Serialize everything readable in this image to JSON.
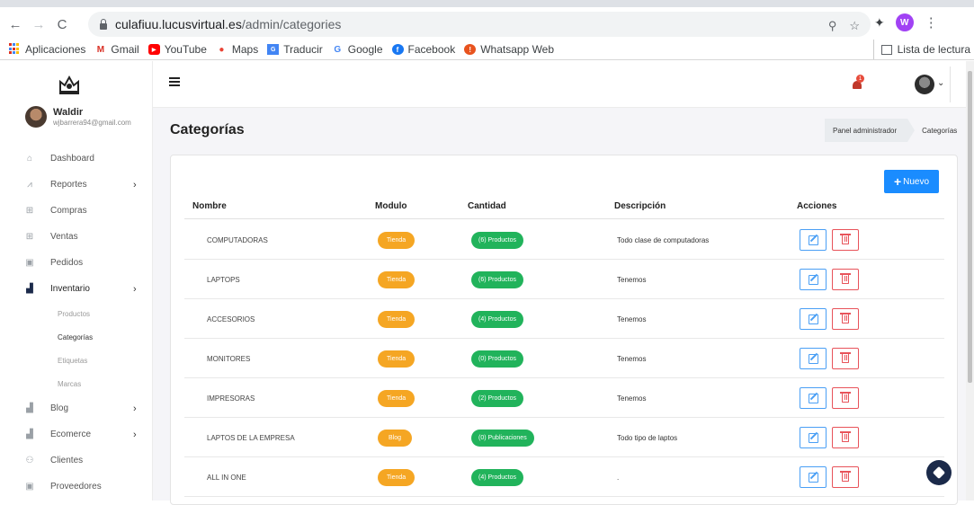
{
  "browser": {
    "url_host": "culafiuu.lucusvirtual.es",
    "url_path": "/admin/categories",
    "profile_initial": "W",
    "bookmarks": [
      "Aplicaciones",
      "Gmail",
      "YouTube",
      "Maps",
      "Traducir",
      "Google",
      "Facebook",
      "Whatsapp Web"
    ],
    "reading_list": "Lista de lectura"
  },
  "user": {
    "name": "Waldir",
    "email": "wjbarrera94@gmail.com"
  },
  "sidebar": {
    "items": [
      {
        "label": "Dashboard",
        "icon": "home-icon"
      },
      {
        "label": "Reportes",
        "icon": "chart-icon",
        "chevron": "›"
      },
      {
        "label": "Compras",
        "icon": "cart-icon"
      },
      {
        "label": "Ventas",
        "icon": "cart-icon"
      },
      {
        "label": "Pedidos",
        "icon": "truck-icon"
      },
      {
        "label": "Inventario",
        "icon": "boxes-icon",
        "chevron": "›"
      },
      {
        "label": "Blog",
        "icon": "boxes-icon",
        "chevron": "›"
      },
      {
        "label": "Ecomerce",
        "icon": "boxes-icon",
        "chevron": "›"
      },
      {
        "label": "Clientes",
        "icon": "users-icon"
      },
      {
        "label": "Proveedores",
        "icon": "truck-icon"
      }
    ],
    "inventario_sub": [
      "Productos",
      "Categorías",
      "Etiquetas",
      "Marcas"
    ]
  },
  "topbar": {
    "notification_count": "1"
  },
  "page": {
    "title": "Categorías",
    "breadcrumb": [
      "Panel administrador",
      "Categorías"
    ],
    "new_button": "Nuevo"
  },
  "table": {
    "headers": [
      "Nombre",
      "Modulo",
      "Cantidad",
      "Descripción",
      "Acciones"
    ],
    "rows": [
      {
        "name": "COMPUTADORAS",
        "module": "Tienda",
        "count": "(6) Productos",
        "description": "Todo clase de computadoras"
      },
      {
        "name": "LAPTOPS",
        "module": "Tienda",
        "count": "(6) Productos",
        "description": "Tenemos"
      },
      {
        "name": "ACCESORIOS",
        "module": "Tienda",
        "count": "(4) Productos",
        "description": "Tenemos"
      },
      {
        "name": "MONITORES",
        "module": "Tienda",
        "count": "(0) Productos",
        "description": "Tenemos"
      },
      {
        "name": "IMPRESORAS",
        "module": "Tienda",
        "count": "(2) Productos",
        "description": "Tenemos"
      },
      {
        "name": "LAPTOS DE LA EMPRESA",
        "module": "Blog",
        "count": "(0) Publicaciones",
        "description": "Todo tipo de laptos"
      },
      {
        "name": "ALL IN ONE",
        "module": "Tienda",
        "count": "(4) Productos",
        "description": "."
      }
    ]
  },
  "colors": {
    "accent": "#1a8cff",
    "module_badge": "#f5a623",
    "count_badge": "#21b35b",
    "edit": "#4a9ff5",
    "delete": "#e8535a",
    "fab": "#1b2a4a"
  }
}
